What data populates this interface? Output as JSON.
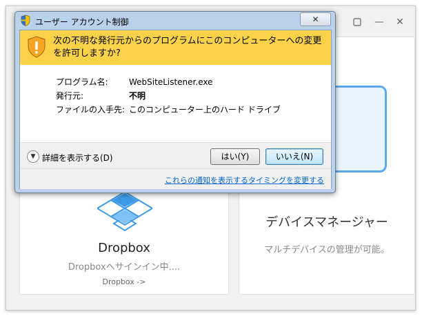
{
  "background_app": {
    "window_controls": {
      "settings_icon": "gear-icon",
      "minimize": "—",
      "close": "✕"
    },
    "device_card": {
      "title": "デバイスマネージャー",
      "description": "マルチデバイスの管理が可能。"
    },
    "dropbox_card": {
      "title": "Dropbox",
      "status": "Dropboxへサインイン中....",
      "link": "Dropbox ->"
    }
  },
  "uac_dialog": {
    "title": "ユーザー アカウント制御",
    "close_label": "✕",
    "question": "次の不明な発行元からのプログラムにこのコンピューターへの変更を許可しますか?",
    "details": {
      "program_name_label": "プログラム名:",
      "program_name_value": "WebSiteListener.exe",
      "publisher_label": "発行元:",
      "publisher_value": "不明",
      "origin_label": "ファイルの入手先:",
      "origin_value": "このコンピューター上のハード ドライブ"
    },
    "expand_label": "詳細を表示する(D)",
    "yes_button": "はい(Y)",
    "no_button": "いいえ(N)",
    "notify_link": "これらの通知を表示するタイミングを変更する"
  },
  "colors": {
    "banner": "#f9d24a",
    "dialog_frame": "#b9d1ea",
    "link": "#0066cc",
    "dropbox_blue": "#3d9ae8"
  }
}
